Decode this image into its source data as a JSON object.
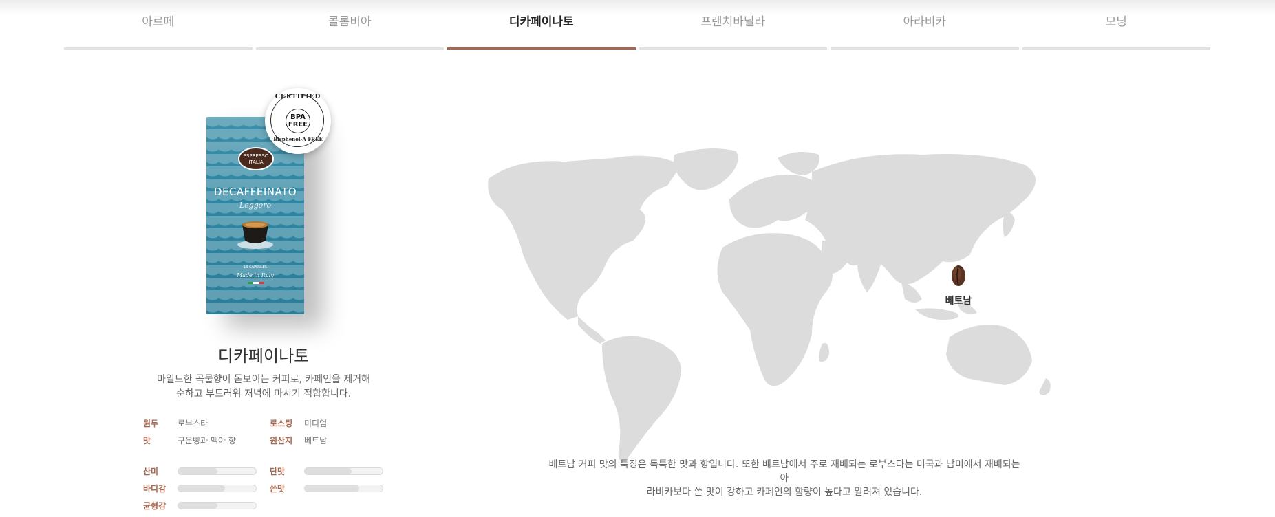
{
  "tabs": [
    {
      "label": "아르떼",
      "active": false
    },
    {
      "label": "콜롬비아",
      "active": false
    },
    {
      "label": "디카페이나토",
      "active": true
    },
    {
      "label": "프렌치바닐라",
      "active": false
    },
    {
      "label": "아라비카",
      "active": false
    },
    {
      "label": "모닝",
      "active": false
    }
  ],
  "product": {
    "pack": {
      "logo": "ESPRESSO ITALIA",
      "name": "DECAFFEINATO",
      "sub": "Leggero",
      "capsules": "16 CAPSULES",
      "made": "Made in Italy"
    },
    "seal": {
      "top": "CERTIFIED",
      "mid": "BPA FREE",
      "bottom": "Bisphenol-A FREE"
    },
    "title": "디카페이나토",
    "desc_line1": "마일드한 곡물향이 돋보이는 커피로, 카페인을 제거해",
    "desc_line2": "순하고 부드러워 저녁에 마시기 적합합니다.",
    "specs": {
      "bean_label": "원두",
      "bean_value": "로부스타",
      "roast_label": "로스팅",
      "roast_value": "미디엄",
      "taste_label": "맛",
      "taste_value": "구운빵과 맥아 향",
      "origin_label": "원산지",
      "origin_value": "베트남"
    },
    "bars": {
      "acidity_label": "산미",
      "acidity": 0.5,
      "sweet_label": "단맛",
      "sweet": 0.6,
      "body_label": "바디감",
      "body": 0.6,
      "bitter_label": "쓴맛",
      "bitter": 0.7,
      "balance_label": "균형감",
      "balance": 0.5
    }
  },
  "map": {
    "pin_label": "베트남",
    "desc_line1": "베트남 커피 맛의 특징은 독특한 맛과 향입니다. 또한 베트남에서 주로 재배되는 로부스타는 미국과 남미에서 재배되는 아",
    "desc_line2": "라비카보다 쓴 맛이 강하고 카페인의 함량이 높다고 알려져 있습니다."
  },
  "colors": {
    "accent": "#a5674e",
    "land": "#dcdcdc"
  }
}
